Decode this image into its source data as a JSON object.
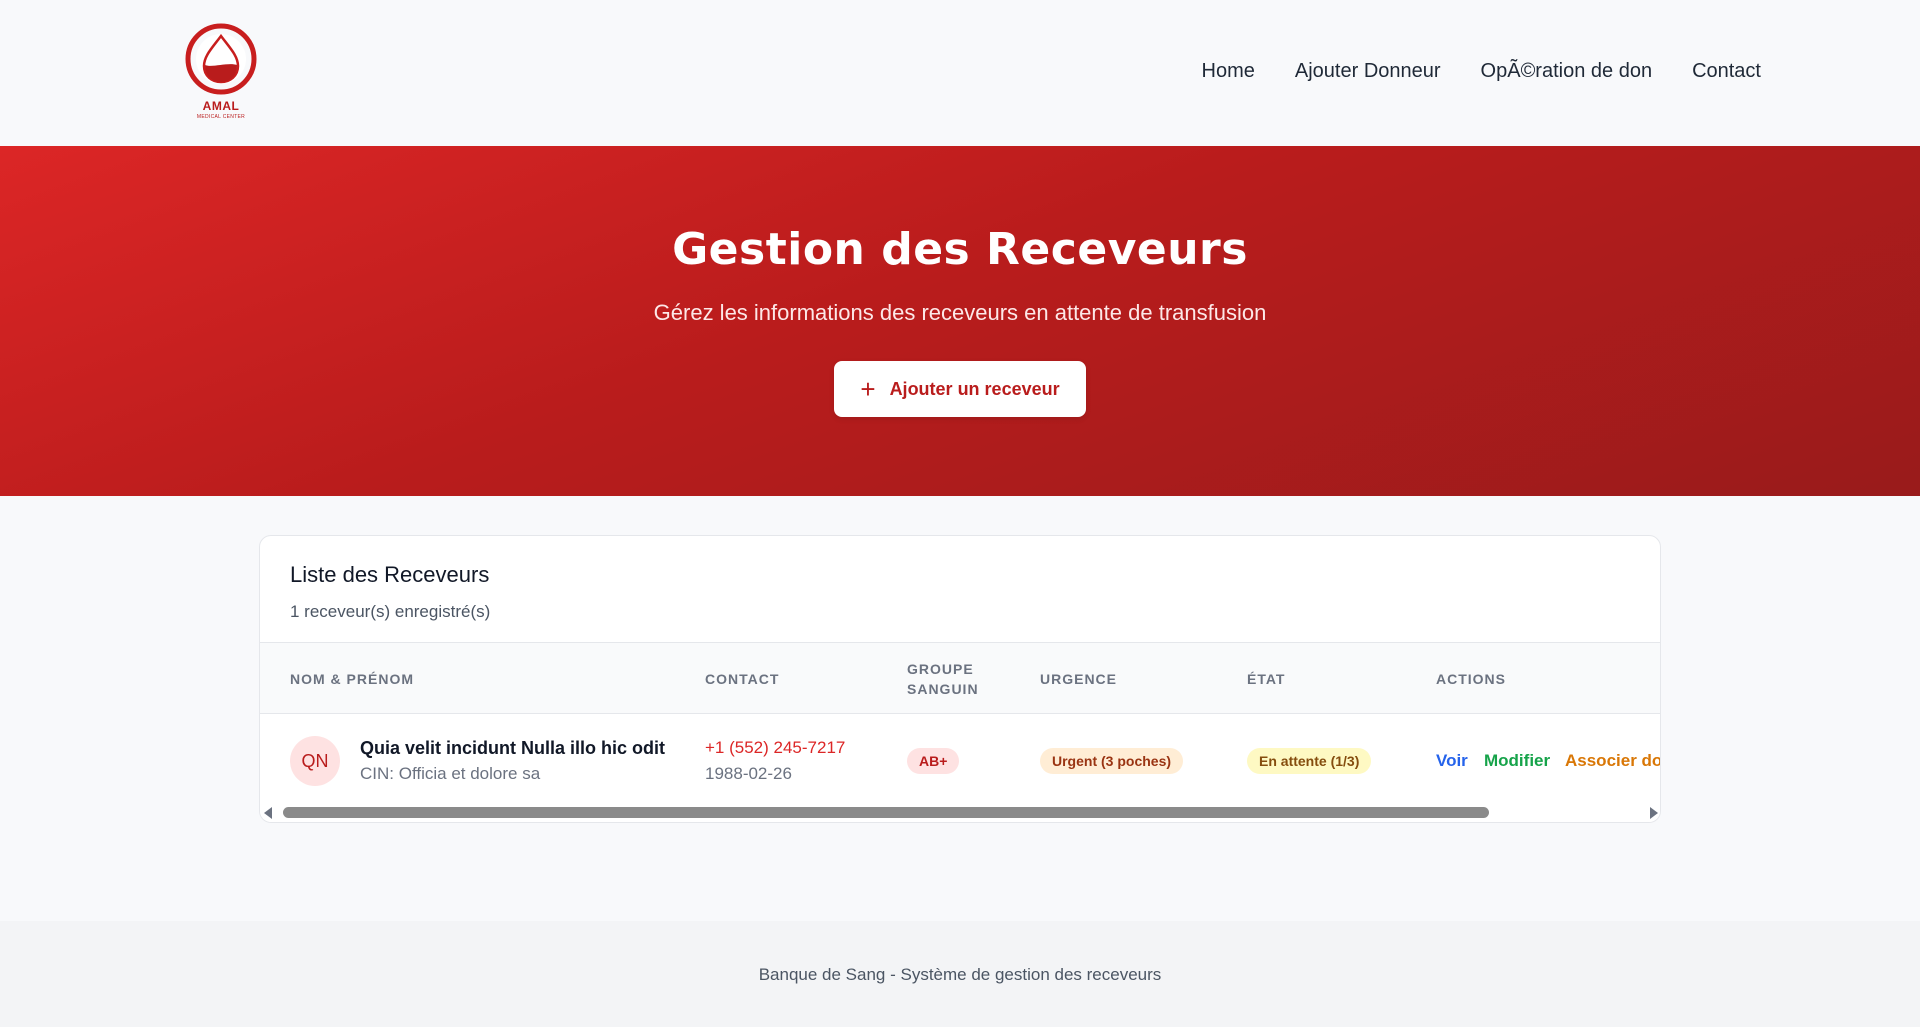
{
  "brand": {
    "name": "AMAL",
    "tagline": "MEDICAL CENTER",
    "accent": "#b91c1c"
  },
  "nav": {
    "items": [
      {
        "label": "Home"
      },
      {
        "label": "Ajouter Donneur"
      },
      {
        "label": "OpÃ©ration de don"
      },
      {
        "label": "Contact"
      }
    ]
  },
  "hero": {
    "title": "Gestion des Receveurs",
    "subtitle": "Gérez les informations des receveurs en attente de transfusion",
    "button_icon": "plus-icon",
    "button_label": "Ajouter un receveur"
  },
  "list": {
    "title": "Liste des Receveurs",
    "count_text": "1 receveur(s) enregistré(s)",
    "headers": {
      "name": "NOM & PRÉNOM",
      "contact": "CONTACT",
      "blood_group": "GROUPE SANGUIN",
      "urgency": "URGENCE",
      "state": "ÉTAT",
      "actions": "ACTIONS"
    },
    "rows": [
      {
        "initials": "QN",
        "name": "Quia velit incidunt Nulla illo hic odit",
        "cin": "CIN: Officia et dolore sa",
        "phone": "+1 (552) 245-7217",
        "dob": "1988-02-26",
        "blood_group": "AB+",
        "urgency": "Urgent (3 poches)",
        "state": "En attente (1/3)",
        "actions": {
          "view": "Voir",
          "edit": "Modifier",
          "associate": "Associer don"
        }
      }
    ]
  },
  "footer": {
    "text": "Banque de Sang - Système de gestion des receveurs"
  }
}
